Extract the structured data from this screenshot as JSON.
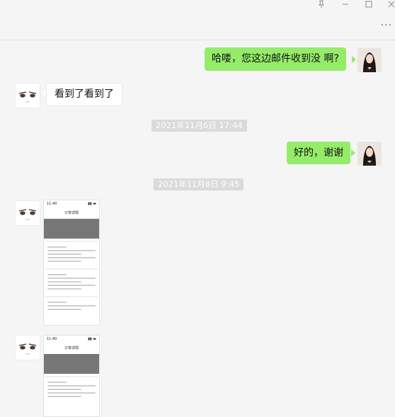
{
  "window": {
    "pin_icon": "pin-icon",
    "minimize_icon": "minimize-icon",
    "maximize_icon": "maximize-icon",
    "close_icon": "close-icon",
    "more_label": "···"
  },
  "messages": [
    {
      "side": "mine",
      "text": "哈喽，您这边邮件收到没 啊?"
    },
    {
      "side": "theirs",
      "text": "看到了看到了"
    },
    {
      "type": "time",
      "text": "2021年11月6日 17:44"
    },
    {
      "side": "mine",
      "text": "好的，谢谢"
    },
    {
      "type": "time",
      "text": "2021年11月8日 9:45"
    }
  ],
  "phone_screenshot": {
    "status_time": "11:40",
    "status_right": "▮▮ ▬",
    "page_title": "订单详情"
  }
}
